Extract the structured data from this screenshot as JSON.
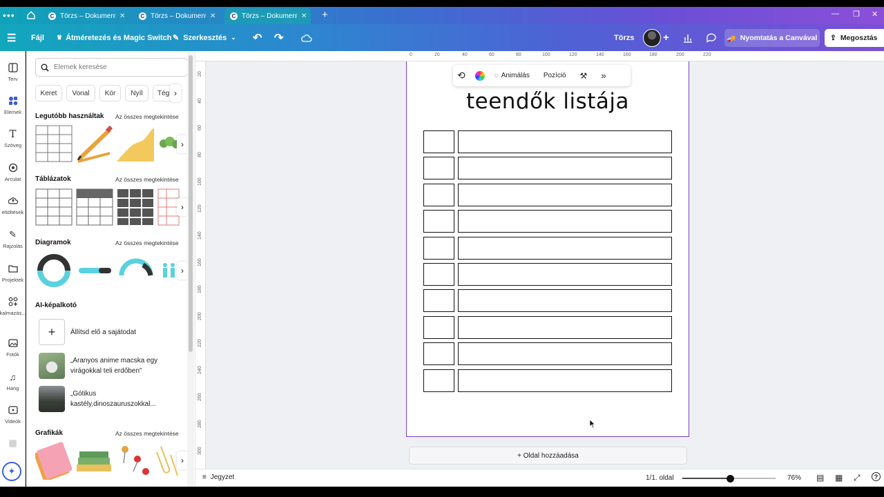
{
  "browser": {
    "tabs": [
      {
        "title": "Törzs – Dokumentu...",
        "active": false
      },
      {
        "title": "Törzs – Dokumentu...",
        "active": false
      },
      {
        "title": "Törzs – Dokumentu...",
        "active": true
      }
    ],
    "new_tab": "+"
  },
  "toolbar": {
    "file": "Fájl",
    "resize": "Átméretezés és Magic Switch",
    "edit": "Szerkesztés",
    "doc_name": "Törzs",
    "print": "Nyomtatás a Canvával",
    "share": "Megosztás"
  },
  "rail": [
    {
      "label": "Terv",
      "icon": "layout-icon"
    },
    {
      "label": "Elemek",
      "icon": "elements-icon"
    },
    {
      "label": "Szöveg",
      "icon": "text-icon"
    },
    {
      "label": "Arculat",
      "icon": "brand-icon"
    },
    {
      "label": "eltöltések",
      "icon": "upload-icon"
    },
    {
      "label": "Rajzolás",
      "icon": "draw-icon"
    },
    {
      "label": "Projektek",
      "icon": "folder-icon"
    },
    {
      "label": "kalmazás...",
      "icon": "apps-icon"
    },
    {
      "label": "Fotók",
      "icon": "photo-icon"
    },
    {
      "label": "Hang",
      "icon": "music-icon"
    },
    {
      "label": "Videók",
      "icon": "video-icon"
    }
  ],
  "panel": {
    "search_placeholder": "Elemek keresése",
    "chips": [
      "Keret",
      "Vonal",
      "Kör",
      "Nyíl",
      "Téglal"
    ],
    "see_all": "Az összes megtekintése",
    "sections": {
      "recent": "Legutóbb használtak",
      "tables": "Táblázatok",
      "diagrams": "Diagramok",
      "ai": "AI-képalkotó",
      "graphics": "Grafikák"
    },
    "ai_items": [
      "Állítsd elő a sajátodat",
      "„Aranyos anime macska egy virágokkal teli erdőben”",
      "„Gótikus kastély,dinoszauruszokkal..."
    ]
  },
  "ruler": {
    "top": [
      "0",
      "20",
      "40",
      "60",
      "80",
      "100",
      "120",
      "140",
      "160",
      "180",
      "200",
      "220"
    ],
    "left": [
      "20",
      "40",
      "60",
      "80",
      "100",
      "120",
      "140",
      "160",
      "180",
      "200",
      "220",
      "240",
      "260",
      "280",
      "300"
    ]
  },
  "floating_bar": {
    "animate": "Animálás",
    "position": "Pozíció"
  },
  "page": {
    "title": "teendők listája",
    "row_count": 10
  },
  "add_page": "+ Oldal hozzáadása",
  "bottom": {
    "notes": "Jegyzet",
    "page_indicator": "1/1. oldal",
    "zoom": "76%",
    "zoom_level": 0.76
  },
  "colors": {
    "accent": "#7b4fd6",
    "page_border": "#7a3fc6"
  }
}
